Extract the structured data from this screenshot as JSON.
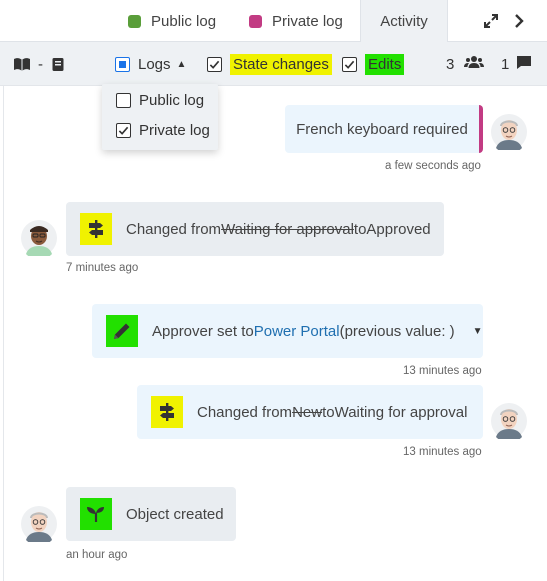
{
  "tabs": {
    "public_log": "Public log",
    "private_log": "Private log",
    "activity": "Activity",
    "public_color": "#5a9e3a",
    "private_color": "#c23b83"
  },
  "toolbar": {
    "separator": "-",
    "logs_label": "Logs",
    "state_changes_label": "State changes",
    "edits_label": "Edits",
    "users_count": "3",
    "comments_count": "1"
  },
  "logs_menu": {
    "public_log": "Public log",
    "private_log": "Private log"
  },
  "feed": {
    "entry1": {
      "text": "French keyboard required",
      "time": "a few seconds ago",
      "accent": "#c23b83"
    },
    "entry2": {
      "prefix": "Changed from ",
      "old": "Waiting for approval",
      "mid": " to ",
      "new": "Approved",
      "time": "7 minutes ago"
    },
    "entry3": {
      "prefix": "Approver set to ",
      "link": "Power Portal",
      "suffix": " (previous value: )",
      "time": "13 minutes ago"
    },
    "entry4": {
      "prefix": "Changed from ",
      "old": "New",
      "mid": " to ",
      "new": "Waiting for approval",
      "time": "13 minutes ago"
    },
    "entry5": {
      "text": "Object created",
      "time": "an hour ago"
    }
  },
  "highlight_colors": {
    "yellow": "#f0f200",
    "green": "#22e000"
  }
}
